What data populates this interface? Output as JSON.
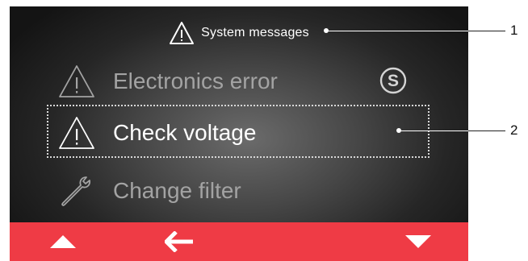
{
  "header": {
    "title": "System messages",
    "icon": "warning-triangle-icon"
  },
  "messages": [
    {
      "label": "Electronics error",
      "icon": "warning-triangle-icon",
      "state": "dimmed",
      "badge": "S"
    },
    {
      "label": "Check voltage",
      "icon": "warning-triangle-icon",
      "state": "selected"
    },
    {
      "label": "Change filter",
      "icon": "wrench-icon",
      "state": "dimmed"
    }
  ],
  "nav": {
    "up_icon": "arrow-up-icon",
    "back_icon": "arrow-left-icon",
    "down_icon": "arrow-down-icon"
  },
  "callouts": {
    "one": "1",
    "two": "2"
  },
  "colors": {
    "nav_bar": "#ef3b45",
    "selected_text": "#ffffff",
    "dimmed_text": "#a3a3a3",
    "screen_bg": "#2a2a2a"
  }
}
